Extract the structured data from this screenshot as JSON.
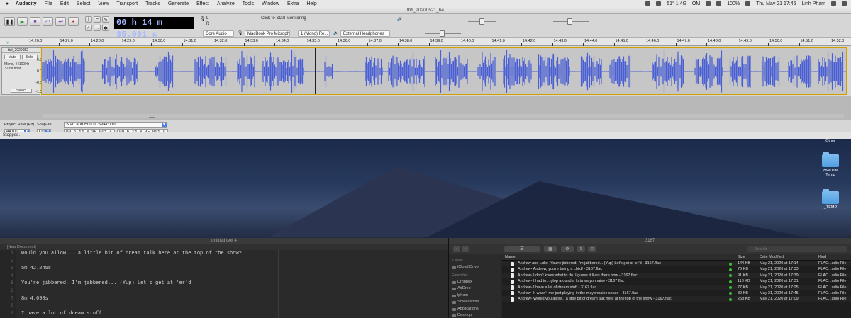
{
  "menubar": {
    "app": "Audacity",
    "items": [
      "File",
      "Edit",
      "Select",
      "View",
      "Transport",
      "Tracks",
      "Generate",
      "Effect",
      "Analyze",
      "Tools",
      "Window",
      "Extra",
      "Help"
    ],
    "temp": "51° 1.4G",
    "om": "OM",
    "battery": "100%",
    "datetime": "Thu May 21  17:46",
    "user": "Linh Pham"
  },
  "audacity": {
    "window_title": "tbtl_20200521_64",
    "time_display": "00 h 14 m 35.001 s",
    "monitoring": "Click to Start Monitoring",
    "meter_l": "L",
    "meter_r": "R",
    "host": "Core Audio",
    "recording_device": "MacBook Pro Microph...",
    "channels": "1 (Mono) Re...",
    "playback_device": "External Headphones",
    "ruler_ticks": [
      "14:26.0",
      "14:27.0",
      "14:28.0",
      "14:29.0",
      "14:30.0",
      "14:31.0",
      "14:32.0",
      "14:33.0",
      "14:34.0",
      "14:35.0",
      "14:36.0",
      "14:37.0",
      "14:38.0",
      "14:39.0",
      "14:40.0",
      "14:41.0",
      "14:42.0",
      "14:43.0",
      "14:44.0",
      "14:45.0",
      "14:46.0",
      "14:47.0",
      "14:48.0",
      "14:49.0",
      "14:50.0",
      "14:51.0",
      "14:52.0"
    ],
    "track": {
      "name": "tbtl_2020052",
      "mute": "Mute",
      "solo": "Solo",
      "info_1": "Mono, 44100Hz",
      "info_2": "32-bit float",
      "select": "Select",
      "scale": [
        "1.0",
        "0.5",
        "0.0",
        "-0.5",
        "-1.0"
      ]
    },
    "selection_bar": {
      "rate_label": "Project Rate (Hz)",
      "rate_value": "44100",
      "snap_label": "Snap-To",
      "snap_value": "Off",
      "mode": "Start and End of Selection",
      "start": "00 h 14 m 35.001 s",
      "end": "00 h 14 m 35.001 s"
    },
    "status": "Stopped."
  },
  "desktop": {
    "icons": [
      "Other",
      "WWDTM Temp",
      "_TEMP"
    ]
  },
  "editor": {
    "window_title": "untitled text 4",
    "tab": "[New Document]",
    "line_numbers": [
      "1",
      "2",
      "3",
      "4",
      "5",
      "6",
      "7",
      "8",
      "9"
    ],
    "lines": [
      "Would you allow... a little bit of dream talk here at the top of the show?",
      "",
      "5m 42.245s",
      "",
      "You're jibbered, I'm jabbered... (Yup) Let's get at 'er'd",
      "",
      "8m 4.698s",
      "",
      "I have a lot of dream stuff"
    ]
  },
  "finder": {
    "window_title": "3167",
    "search_placeholder": "Search",
    "sidebar": {
      "icloud_header": "iCloud",
      "icloud_items": [
        "iCloud Drive"
      ],
      "favorites_header": "Favorites",
      "favorite_items": [
        "Dropbox",
        "AirDrop",
        "lpham",
        "Screenshots",
        "Applications",
        "Desktop"
      ]
    },
    "columns": {
      "name": "Name",
      "size": "Size",
      "date": "Date Modified",
      "kind": "Kind"
    },
    "files": [
      {
        "name": "Andrew and Luke- You're jibbered, I'm jabbered... (Yup) Let's get at 'er'd - 3167.flac",
        "size": "144 KB",
        "date": "May 21, 2020 at 17:14",
        "kind": "FLAC...udio File"
      },
      {
        "name": "Andrew- Andrew, you're being a child! - 3167.flac",
        "size": "76 KB",
        "date": "May 21, 2020 at 17:33",
        "kind": "FLAC...udio File"
      },
      {
        "name": "Andrew- I don't know what to do. I guess it lives there now - 3167.flac",
        "size": "91 KB",
        "date": "May 21, 2020 at 17:39",
        "kind": "FLAC...udio File"
      },
      {
        "name": "Andrew- I had to... glop around a lotta mayonnaise - 3167.flac",
        "size": "113 KB",
        "date": "May 21, 2020 at 17:31",
        "kind": "FLAC...udio File"
      },
      {
        "name": "Andrew- I have a lot of dream stuff - 3167.flac",
        "size": "77 KB",
        "date": "May 21, 2020 at 17:25",
        "kind": "FLAC...udio File"
      },
      {
        "name": "Andrew- It wasn't me just playing in the mayonnaise space - 3167.flac",
        "size": "89 KB",
        "date": "May 21, 2020 at 17:45",
        "kind": "FLAC...udio File"
      },
      {
        "name": "Andrew- Would you allow... a little bit of dream talk here at the top of the show - 3167.flac",
        "size": "268 KB",
        "date": "May 21, 2020 at 17:09",
        "kind": "FLAC...udio File"
      }
    ]
  },
  "colors": {
    "waveform": "#4a5fd6",
    "time_text": "#a6b8ff",
    "status_dot": "#3dbb3d"
  }
}
